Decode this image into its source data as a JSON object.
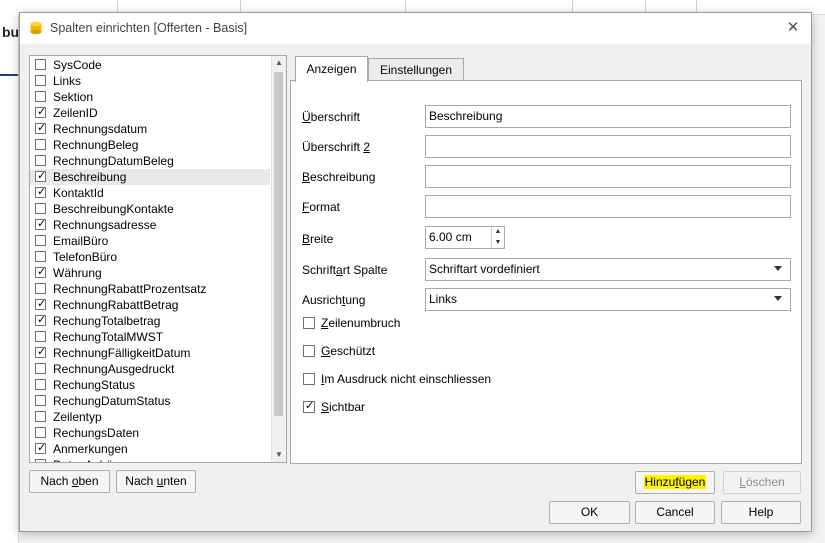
{
  "background": {
    "strip_text": "bu"
  },
  "dialog": {
    "title": "Spalten einrichten [Offerten - Basis]",
    "close_glyph": "✕"
  },
  "columns": [
    {
      "label": "SysCode",
      "checked": false
    },
    {
      "label": "Links",
      "checked": false
    },
    {
      "label": "Sektion",
      "checked": false
    },
    {
      "label": "ZeilenID",
      "checked": true
    },
    {
      "label": "Rechnungsdatum",
      "checked": true
    },
    {
      "label": "RechnungBeleg",
      "checked": false
    },
    {
      "label": "RechnungDatumBeleg",
      "checked": false
    },
    {
      "label": "Beschreibung",
      "checked": true,
      "selected": true
    },
    {
      "label": "KontaktId",
      "checked": true
    },
    {
      "label": "BeschreibungKontakte",
      "checked": false
    },
    {
      "label": "Rechnungsadresse",
      "checked": true
    },
    {
      "label": "EmailBüro",
      "checked": false
    },
    {
      "label": "TelefonBüro",
      "checked": false
    },
    {
      "label": "Währung",
      "checked": true
    },
    {
      "label": "RechnungRabattProzentsatz",
      "checked": false
    },
    {
      "label": "RechnungRabattBetrag",
      "checked": true
    },
    {
      "label": "RechungTotalbetrag",
      "checked": true
    },
    {
      "label": "RechungTotalMWST",
      "checked": false
    },
    {
      "label": "RechnungFälligkeitDatum",
      "checked": true
    },
    {
      "label": "RechnungAusgedruckt",
      "checked": false
    },
    {
      "label": "RechungStatus",
      "checked": false
    },
    {
      "label": "RechungDatumStatus",
      "checked": false
    },
    {
      "label": "Zeilentyp",
      "checked": false
    },
    {
      "label": "RechungsDaten",
      "checked": false
    },
    {
      "label": "Anmerkungen",
      "checked": true
    },
    {
      "label": "DatenAnhäng",
      "checked": false
    }
  ],
  "list_buttons": {
    "up_pre": "Nach ",
    "up_key": "o",
    "up_post": "ben",
    "down_pre": "Nach ",
    "down_key": "u",
    "down_post": "nten"
  },
  "tabs": {
    "display": "Anzeigen",
    "settings": "Einstellungen"
  },
  "form": {
    "heading_label_key": "Ü",
    "heading_label_rest": "berschrift",
    "heading_value": "Beschreibung",
    "heading2_label_pre": "Überschrift ",
    "heading2_label_key": "2",
    "heading2_value": "",
    "description_label_key": "B",
    "description_label_rest": "eschreibung",
    "description_value": "",
    "format_label_key": "F",
    "format_label_rest": "ormat",
    "format_value": "",
    "width_label_key": "B",
    "width_label_rest": "reite",
    "width_value": "6.00 cm",
    "font_label_pre": "Schrift",
    "font_label_key": "a",
    "font_label_post": "rt Spalte",
    "font_value": "Schriftart vordefiniert",
    "align_label_pre": "Ausrich",
    "align_label_key": "t",
    "align_label_post": "ung",
    "align_value": "Links"
  },
  "options": [
    {
      "key": "Z",
      "rest": "eilenumbruch",
      "checked": false
    },
    {
      "key": "G",
      "rest": "eschützt",
      "checked": false
    },
    {
      "key": "I",
      "rest": "m Ausdruck nicht einschliessen",
      "checked": false
    },
    {
      "key": "S",
      "rest": "ichtbar",
      "checked": true
    }
  ],
  "actions": {
    "add_pre": "Hinzu",
    "add_key": "f",
    "add_post": "ügen",
    "delete_key": "L",
    "delete_rest": "öschen",
    "ok": "OK",
    "cancel": "Cancel",
    "help": "Help"
  },
  "icons": {
    "check": "✓",
    "scroll_up": "▲",
    "scroll_down": "▼",
    "spin_up": "▲",
    "spin_down": "▼"
  },
  "colors": {
    "highlight": "#fff200",
    "app_icon": "#f2b600"
  }
}
